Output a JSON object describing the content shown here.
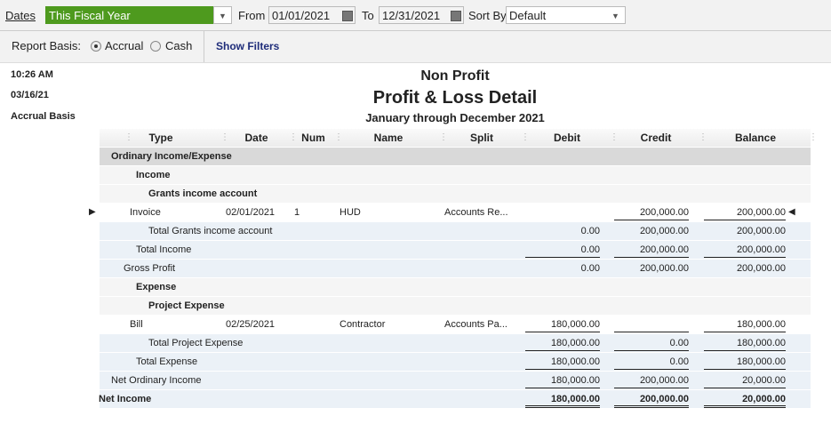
{
  "toolbar": {
    "dates_label": "Dates",
    "dates_value": "This Fiscal Year",
    "from_label": "From",
    "from_value": "01/01/2021",
    "to_label": "To",
    "to_value": "12/31/2021",
    "sortby_label": "Sort By",
    "sortby_value": "Default"
  },
  "filters": {
    "basis_label": "Report Basis:",
    "accrual": "Accrual",
    "cash": "Cash",
    "selected": "Accrual",
    "show_filters": "Show Filters"
  },
  "side": {
    "time": "10:26 AM",
    "date": "03/16/21",
    "basis": "Accrual Basis"
  },
  "report": {
    "company": "Non Profit",
    "title": "Profit & Loss Detail",
    "period": "January through December 2021"
  },
  "columns": [
    "Type",
    "Date",
    "Num",
    "Name",
    "Split",
    "Debit",
    "Credit",
    "Balance"
  ],
  "rows": [
    {
      "label": "Ordinary Income/Expense",
      "kind": "section",
      "indent": 0
    },
    {
      "label": "Income",
      "kind": "group",
      "indent": 1
    },
    {
      "label": "Grants income account",
      "kind": "group",
      "indent": 2
    },
    {
      "kind": "detail",
      "type": "Invoice",
      "date": "02/01/2021",
      "num": "1",
      "name": "HUD",
      "split": "Accounts Re...",
      "debit": "",
      "credit": "200,000.00",
      "balance": "200,000.00"
    },
    {
      "label": "Total Grants income account",
      "kind": "total",
      "indent": 3,
      "debit": "0.00",
      "credit": "200,000.00",
      "balance": "200,000.00"
    },
    {
      "label": "Total Income",
      "kind": "total",
      "indent": 2,
      "debit": "0.00",
      "credit": "200,000.00",
      "balance": "200,000.00"
    },
    {
      "label": "Gross Profit",
      "kind": "total",
      "indent": 1,
      "debit": "0.00",
      "credit": "200,000.00",
      "balance": "200,000.00"
    },
    {
      "label": "Expense",
      "kind": "group",
      "indent": 1
    },
    {
      "label": "Project Expense",
      "kind": "group",
      "indent": 2
    },
    {
      "kind": "detail",
      "type": "Bill",
      "date": "02/25/2021",
      "num": "",
      "name": "Contractor",
      "split": "Accounts Pa...",
      "debit": "180,000.00",
      "credit": "",
      "balance": "180,000.00"
    },
    {
      "label": "Total Project Expense",
      "kind": "total",
      "indent": 3,
      "debit": "180,000.00",
      "credit": "0.00",
      "balance": "180,000.00"
    },
    {
      "label": "Total Expense",
      "kind": "total",
      "indent": 2,
      "debit": "180,000.00",
      "credit": "0.00",
      "balance": "180,000.00"
    },
    {
      "label": "Net Ordinary Income",
      "kind": "total",
      "indent": 0,
      "debit": "180,000.00",
      "credit": "200,000.00",
      "balance": "20,000.00"
    },
    {
      "label": "Net Income",
      "kind": "net",
      "indent": -1,
      "debit": "180,000.00",
      "credit": "200,000.00",
      "balance": "20,000.00"
    }
  ]
}
